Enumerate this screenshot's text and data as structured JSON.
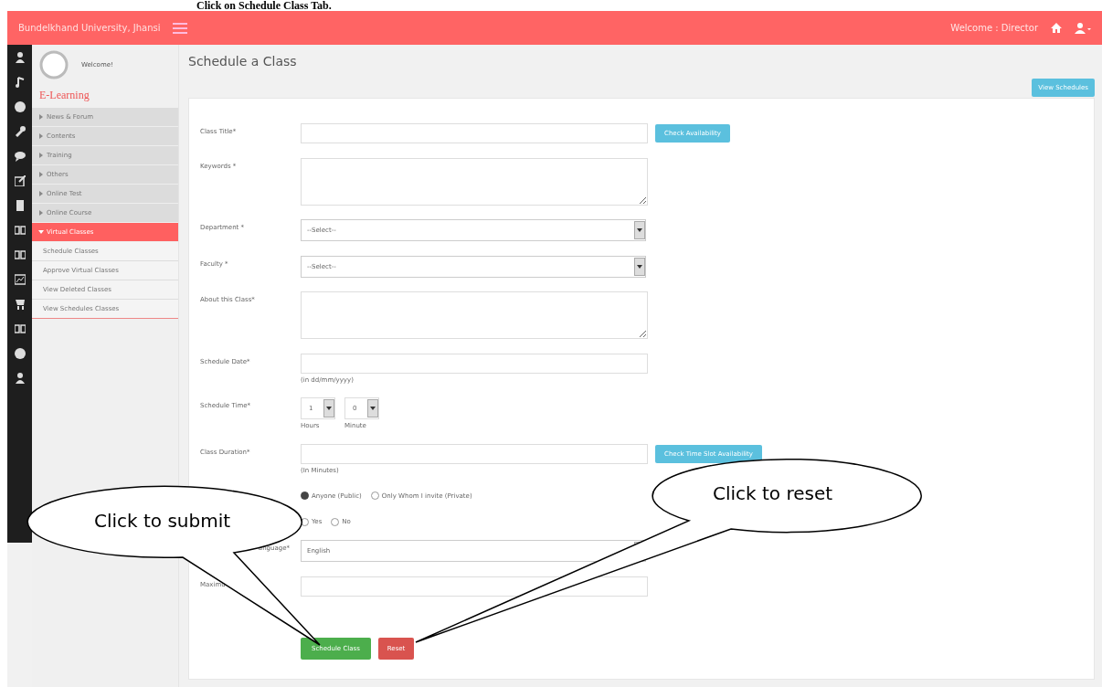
{
  "doc_heading": "Click on Schedule Class Tab.",
  "topbar": {
    "brand": "Bundelkhand University, Jhansi",
    "welcome": "Welcome : Director"
  },
  "sidebar": {
    "greeting": "Welcome!",
    "section": "E-Learning",
    "items": [
      {
        "label": "News & Forum",
        "selected": false,
        "expanded": false
      },
      {
        "label": "Contents",
        "selected": false,
        "expanded": false
      },
      {
        "label": "Training",
        "selected": false,
        "expanded": false
      },
      {
        "label": "Others",
        "selected": false,
        "expanded": false
      },
      {
        "label": "Online Test",
        "selected": false,
        "expanded": false
      },
      {
        "label": "Online Course",
        "selected": false,
        "expanded": false
      },
      {
        "label": "Virtual Classes",
        "selected": true,
        "expanded": true,
        "children": [
          "Schedule Classes",
          "Approve Virtual Classes",
          "View Deleted Classes",
          "View Schedules Classes"
        ]
      }
    ]
  },
  "page": {
    "title": "Schedule a Class",
    "action": "View Schedules"
  },
  "form": {
    "rows": [
      {
        "kind": "text",
        "label": "Class Title*",
        "button": "Check Availability"
      },
      {
        "kind": "textarea",
        "label": "Keywords *"
      },
      {
        "kind": "select",
        "label": "Department *",
        "value": "--Select--"
      },
      {
        "kind": "select",
        "label": "Faculty *",
        "value": "--Select--"
      },
      {
        "kind": "textarea",
        "label": "About this Class*"
      },
      {
        "kind": "text",
        "label": "Schedule Date*",
        "hint": "(in dd/mm/yyyy)"
      },
      {
        "kind": "time",
        "label": "Schedule Time*",
        "hours": "1",
        "hours_label": "Hours",
        "minute": "0",
        "minute_label": "Minute"
      },
      {
        "kind": "text",
        "label": "Class Duration*",
        "hint": "(In Minutes)",
        "button": "Check Time Slot Availability"
      },
      {
        "kind": "radio",
        "options": [
          {
            "label": "Anyone (Public)",
            "selected": true
          },
          {
            "label": "Only Whom I invite (Private)",
            "selected": false
          }
        ]
      },
      {
        "kind": "radio",
        "options": [
          {
            "label": "Yes",
            "selected": false
          },
          {
            "label": "No",
            "selected": false
          }
        ]
      },
      {
        "kind": "select",
        "label": "anguage*",
        "value": "English"
      },
      {
        "kind": "text",
        "label": "Maximu"
      }
    ],
    "submit": "Schedule Class",
    "reset": "Reset"
  },
  "callouts": [
    {
      "text": "Click to submit"
    },
    {
      "text": "Click to reset"
    }
  ]
}
